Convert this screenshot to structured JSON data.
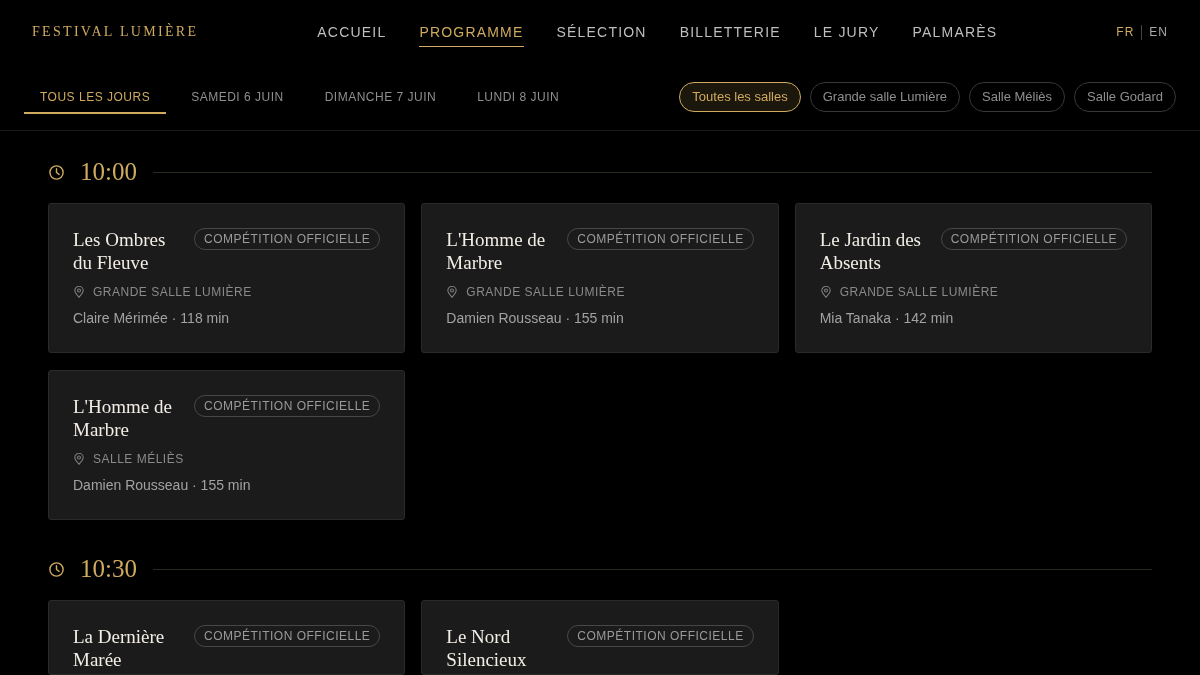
{
  "header": {
    "logo": "FESTIVAL LUMIÈRE",
    "nav": [
      {
        "label": "ACCUEIL",
        "selected": false
      },
      {
        "label": "PROGRAMME",
        "selected": true
      },
      {
        "label": "SÉLECTION",
        "selected": false
      },
      {
        "label": "BILLETTERIE",
        "selected": false
      },
      {
        "label": "LE JURY",
        "selected": false
      },
      {
        "label": "PALMARÈS",
        "selected": false
      }
    ],
    "languages": [
      {
        "label": "FR",
        "selected": true
      },
      {
        "label": "EN",
        "selected": false
      }
    ]
  },
  "day_tabs": [
    {
      "label": "TOUS LES JOURS",
      "selected": true
    },
    {
      "label": "SAMEDI 6 JUIN",
      "selected": false
    },
    {
      "label": "DIMANCHE 7 JUIN",
      "selected": false
    },
    {
      "label": "LUNDI 8 JUIN",
      "selected": false
    }
  ],
  "venue_filters": [
    {
      "label": "Toutes les salles",
      "selected": true
    },
    {
      "label": "Grande salle Lumière",
      "selected": false
    },
    {
      "label": "Salle Méliès",
      "selected": false
    },
    {
      "label": "Salle Godard",
      "selected": false
    }
  ],
  "schedule": [
    {
      "time": "10:00",
      "screenings": [
        {
          "title": "Les Ombres du Fleuve",
          "badge": "COMPÉTITION OFFICIELLE",
          "venue": "GRANDE SALLE LUMIÈRE",
          "credits": "Claire Mérimée · 118 min"
        },
        {
          "title": "L'Homme de Marbre",
          "badge": "COMPÉTITION OFFICIELLE",
          "venue": "GRANDE SALLE LUMIÈRE",
          "credits": "Damien Rousseau · 155 min"
        },
        {
          "title": "Le Jardin des Absents",
          "badge": "COMPÉTITION OFFICIELLE",
          "venue": "GRANDE SALLE LUMIÈRE",
          "credits": "Mia Tanaka · 142 min"
        },
        {
          "title": "L'Homme de Marbre",
          "badge": "COMPÉTITION OFFICIELLE",
          "venue": "SALLE MÉLIÈS",
          "credits": "Damien Rousseau · 155 min"
        }
      ]
    },
    {
      "time": "10:30",
      "screenings": [
        {
          "title": "La Dernière Marée",
          "badge": "COMPÉTITION OFFICIELLE"
        },
        {
          "title": "Le Nord Silencieux",
          "badge": "COMPÉTITION OFFICIELLE"
        }
      ]
    }
  ]
}
